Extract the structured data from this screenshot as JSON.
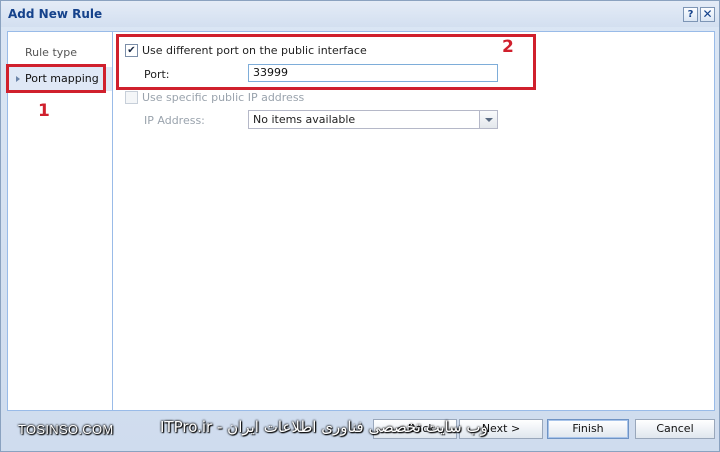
{
  "window": {
    "title": "Add New Rule",
    "help_glyph": "?",
    "close_glyph": "✕"
  },
  "nav": {
    "items": [
      {
        "label": "Rule type",
        "selected": false
      },
      {
        "label": "Port mapping",
        "selected": true
      }
    ]
  },
  "form": {
    "use_different_port": {
      "label": "Use different port on the public interface",
      "checked": true
    },
    "port": {
      "label": "Port:",
      "value": "33999"
    },
    "use_specific_ip": {
      "label": "Use specific public IP address",
      "checked": false,
      "enabled": false
    },
    "ip_address": {
      "label": "IP Address:",
      "value": "No items available"
    }
  },
  "footer": {
    "back_label": "< Back",
    "next_label": "Next >",
    "finish_label": "Finish",
    "cancel_label": "Cancel"
  },
  "annotations": {
    "marker_1": "1",
    "marker_2": "2",
    "highlight_color": "#d0202d"
  },
  "watermarks": {
    "left": "TOSINSO.COM",
    "right": "ITPro.ir - وب سایت تخصصی فناوری اطلاعات ایران"
  }
}
